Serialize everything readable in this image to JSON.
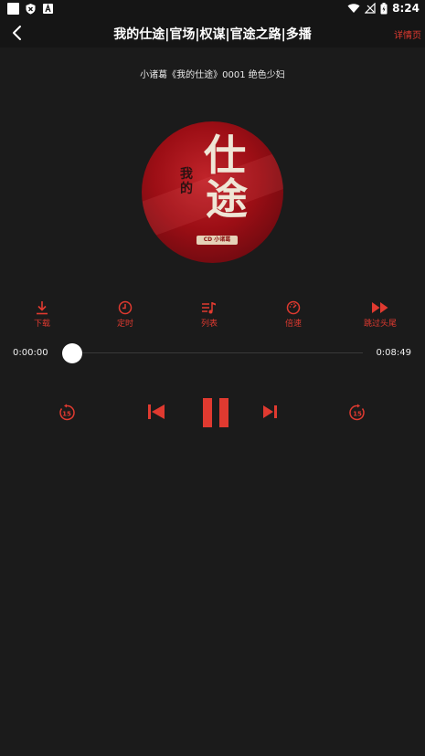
{
  "status": {
    "time": "8:24",
    "accent": "#e03a30"
  },
  "header": {
    "title": "我的仕途|官场|权谋|官途之路|多播",
    "details_label": "详情页"
  },
  "episode": {
    "subtitle": "小诸葛《我的仕途》0001 绝色少妇"
  },
  "cover": {
    "char1": "仕",
    "char2": "途",
    "small_text": "我的",
    "tag": "CD 小诸葛"
  },
  "actions": [
    {
      "label": "下载",
      "icon": "download-icon"
    },
    {
      "label": "定时",
      "icon": "clock-icon"
    },
    {
      "label": "列表",
      "icon": "playlist-icon"
    },
    {
      "label": "倍速",
      "icon": "speed-icon"
    },
    {
      "label": "跳过头尾",
      "icon": "skip-intro-icon"
    }
  ],
  "progress": {
    "current": "0:00:00",
    "total": "0:08:49",
    "fraction": 0
  },
  "controls": {
    "rewind": "15",
    "forward": "15"
  }
}
